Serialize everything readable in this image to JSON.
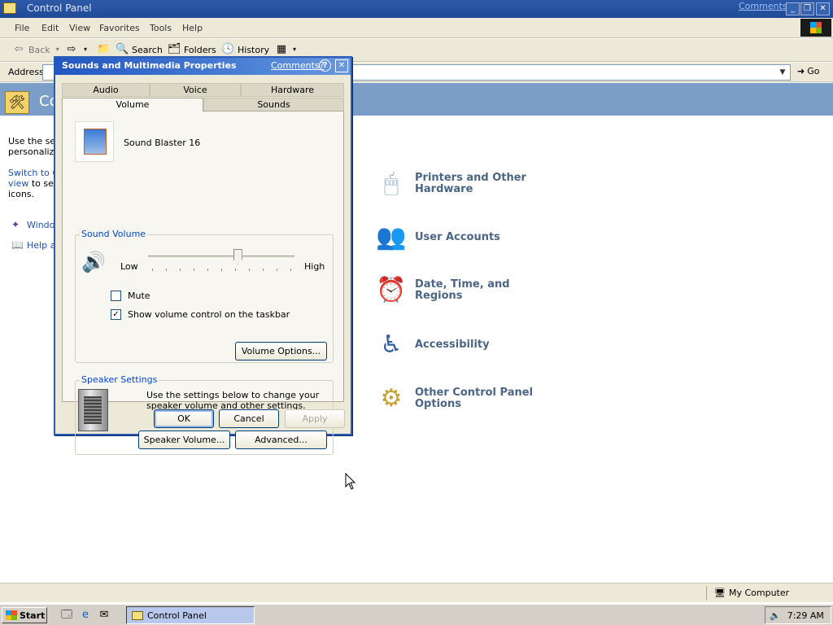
{
  "window": {
    "title": "Control Panel",
    "comments_link": "Comments?",
    "buttons": {
      "minimize": "_",
      "restore": "❐",
      "close": "✕"
    }
  },
  "menu": [
    "File",
    "Edit",
    "View",
    "Favorites",
    "Tools",
    "Help"
  ],
  "toolbar": {
    "back": "Back",
    "search": "Search",
    "folders": "Folders",
    "history": "History"
  },
  "address": {
    "label": "Address",
    "go": "Go"
  },
  "content": {
    "title_partial": "Co",
    "sidebar_text_line1": "Use the set",
    "sidebar_text_line2": "personalize",
    "sidebar_link_line1": "Switch to Cl",
    "sidebar_link_line2a": "view",
    "sidebar_link_line2b": " to see",
    "sidebar_link_line3": "icons.",
    "sidebar_windows_update": "Windo",
    "sidebar_help": "Help a",
    "categories": [
      {
        "label1": "Printers and Other",
        "label2": "Hardware",
        "icon": "mouse-icon"
      },
      {
        "label1": "User Accounts",
        "label2": "",
        "icon": "users-icon"
      },
      {
        "label1": "Date, Time, and",
        "label2": "Regions",
        "icon": "clock-icon"
      },
      {
        "label1": "Accessibility",
        "label2": "",
        "icon": "accessibility-icon"
      },
      {
        "label1": "Other Control Panel",
        "label2": "Options",
        "icon": "folder-gear-icon"
      }
    ]
  },
  "statusbar": {
    "zone": "My Computer"
  },
  "taskbar": {
    "start": "Start",
    "task": "Control Panel",
    "clock": "7:29 AM"
  },
  "dialog": {
    "title": "Sounds and Multimedia Properties",
    "comments": "Comments?",
    "help": "?",
    "close": "✕",
    "tabs_row1": [
      "Audio",
      "Voice",
      "Hardware"
    ],
    "tabs_row2": [
      "Volume",
      "Sounds"
    ],
    "active_tab": "Volume",
    "device_name": "Sound Blaster 16",
    "sound_volume": {
      "group_label": "Sound Volume",
      "low": "Low",
      "high": "High",
      "level_fraction": 0.61,
      "mute_label": "Mute",
      "mute_checked": false,
      "show_volume_label": "Show volume control on the taskbar",
      "show_volume_checked": true,
      "volume_options": "Volume Options..."
    },
    "speaker_settings": {
      "group_label": "Speaker Settings",
      "description": "Use the settings below to change your speaker volume and other settings.",
      "speaker_volume_btn": "Speaker Volume...",
      "advanced_btn": "Advanced..."
    },
    "buttons": {
      "ok": "OK",
      "cancel": "Cancel",
      "apply": "Apply"
    }
  }
}
